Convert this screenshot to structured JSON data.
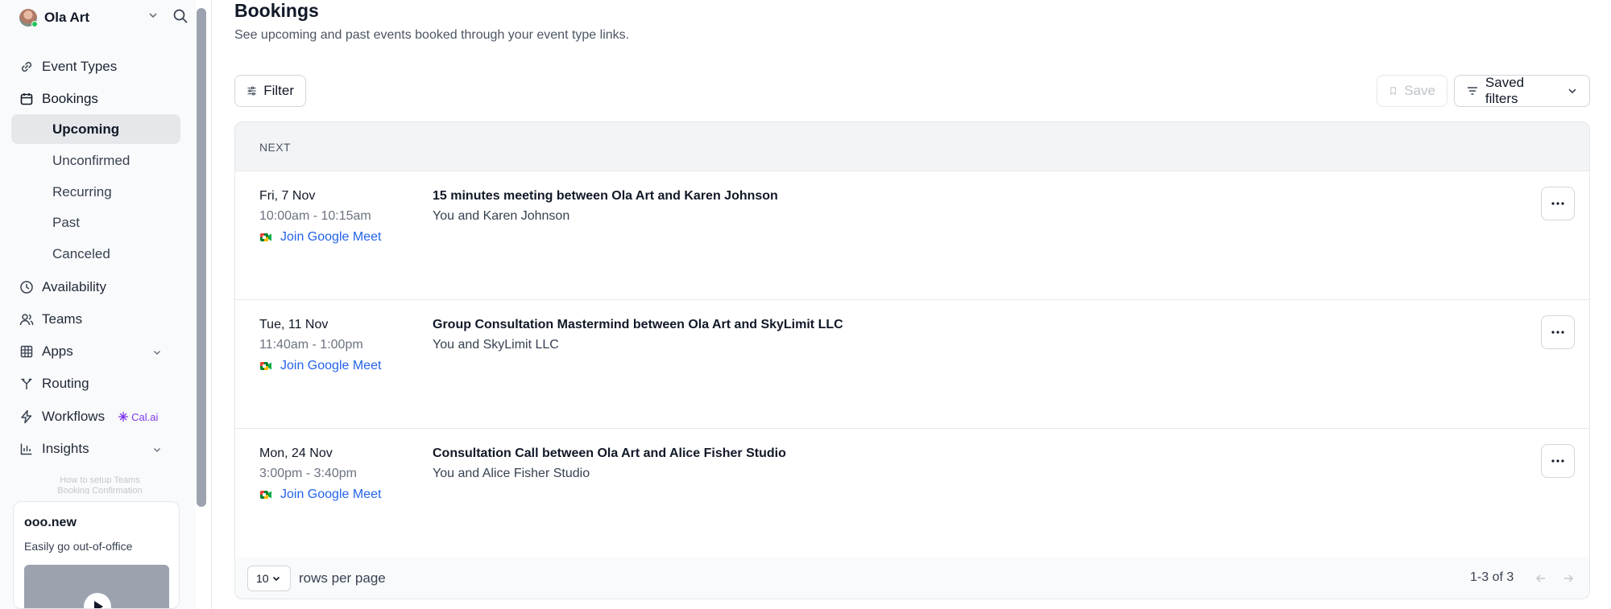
{
  "sidebar": {
    "profile": {
      "name": "Ola Art"
    },
    "nav": {
      "event_types": "Event Types",
      "bookings": "Bookings",
      "bookings_sub": [
        "Upcoming",
        "Unconfirmed",
        "Recurring",
        "Past",
        "Canceled"
      ],
      "availability": "Availability",
      "teams": "Teams",
      "apps": "Apps",
      "routing": "Routing",
      "workflows": "Workflows",
      "workflows_badge": "Cal.ai",
      "insights": "Insights"
    },
    "stacked_cards": [
      "How to setup Teams",
      "Booking Confirmation"
    ],
    "promo": {
      "title": "ooo.new",
      "description": "Easily go out-of-office"
    }
  },
  "header": {
    "title": "Bookings",
    "subtitle": "See upcoming and past events booked through your event type links."
  },
  "toolbar": {
    "filter_label": "Filter",
    "save_label": "Save",
    "saved_filters_label": "Saved filters"
  },
  "table": {
    "section_label": "NEXT",
    "rows": [
      {
        "date": "Fri, 7 Nov",
        "time": "10:00am - 10:15am",
        "meet_label": "Join Google Meet",
        "title": "15 minutes meeting between Ola Art and Karen Johnson",
        "attendees": "You and Karen Johnson"
      },
      {
        "date": "Tue, 11 Nov",
        "time": "11:40am - 1:00pm",
        "meet_label": "Join Google Meet",
        "title": "Group Consultation Mastermind between Ola Art and SkyLimit LLC",
        "attendees": "You and SkyLimit LLC"
      },
      {
        "date": "Mon, 24 Nov",
        "time": "3:00pm - 3:40pm",
        "meet_label": "Join Google Meet",
        "title": "Consultation Call between Ola Art and Alice Fisher Studio",
        "attendees": "You and Alice Fisher Studio"
      }
    ],
    "footer": {
      "rows_per_page_value": "10",
      "rows_per_page_label": "rows per page",
      "page_count": "1-3 of 3"
    }
  },
  "colors": {
    "accent_link": "#2563eb",
    "calai_purple": "#7c3aed",
    "active_bg": "#e5e7eb"
  }
}
